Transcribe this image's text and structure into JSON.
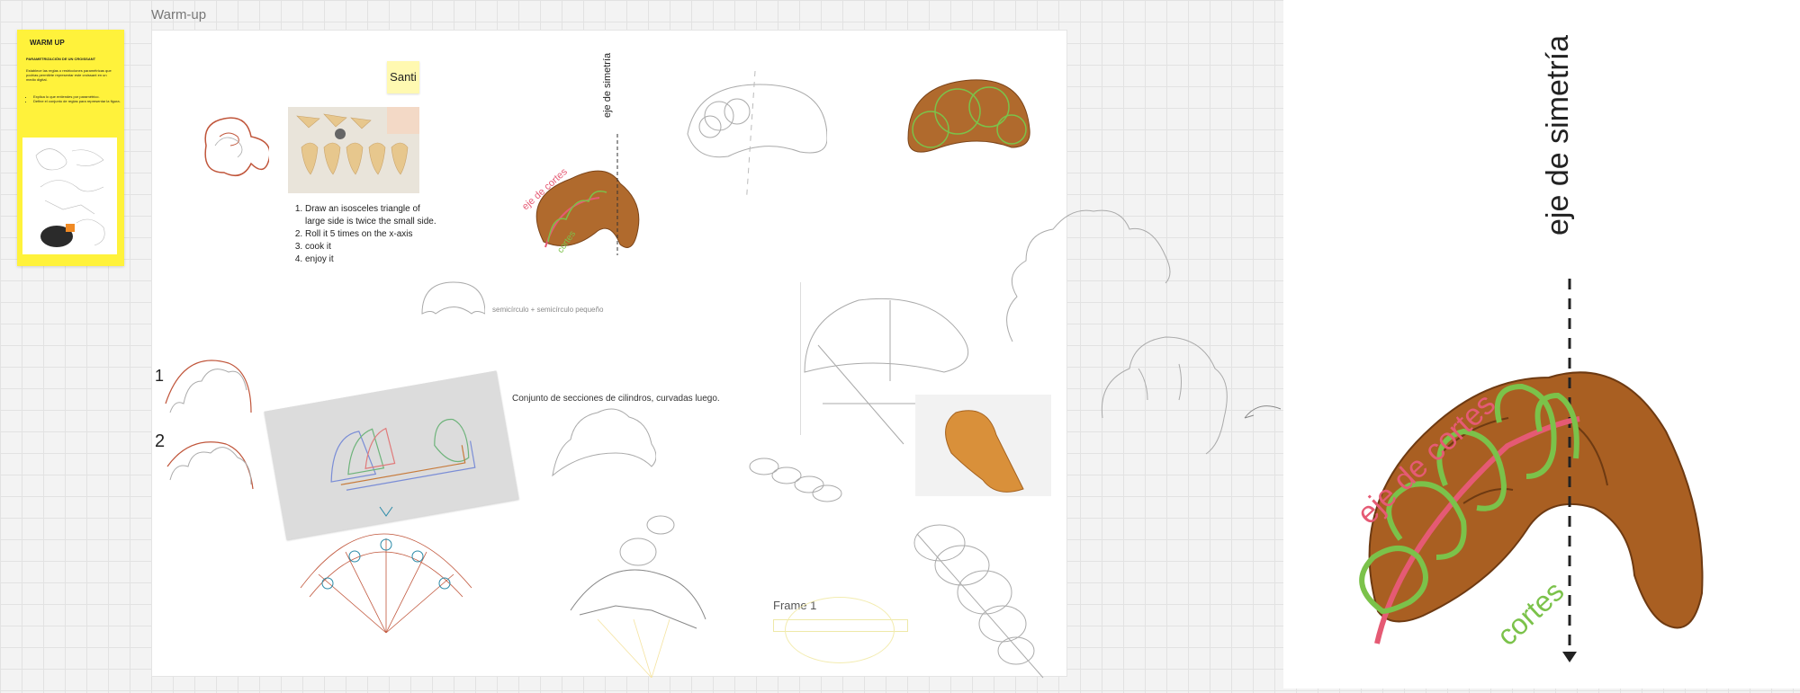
{
  "frame": {
    "title": "Warm-up"
  },
  "warmup_card": {
    "title": "WARM UP",
    "subtitle": "PARAMETRIZACIÓN DE UN CROISSANT",
    "description": "Establece las reglas o restricciones paramétricas que podrías permitirte representar este croissant en un medio digital.",
    "bullets": [
      "Explica lo que entiendes por paramétrico.",
      "Define el conjunto de reglas para representar la figura."
    ]
  },
  "sticky_note": {
    "text": "Santi"
  },
  "steps": [
    "Draw an isosceles triangle of large side is twice the small side.",
    "Roll it 5 times on the x-axis",
    "cook it",
    "enjoy it"
  ],
  "labels": {
    "eje_simetria_small": "eje de simetría",
    "eje_cortes_small": "eje de cortes",
    "cortes_small": "cortes",
    "semicirculo": "semicírculo + semicírculo pequeño",
    "conjunto": "Conjunto de secciones de cilindros, curvadas luego.",
    "one": "1",
    "two": "2",
    "frame1": "Frame 1"
  },
  "zoom_panel": {
    "eje_simetria": "eje de simetría",
    "eje_cortes": "eje de cortes",
    "cortes": "cortes"
  },
  "colors": {
    "canvas": "#f3f3f3",
    "warmup_yellow": "#fff23b",
    "sticky_yellow": "#fff9b1",
    "pink_annotation": "#e55a74",
    "green_annotation": "#7bc24a",
    "croissant": "#b06a2d"
  }
}
